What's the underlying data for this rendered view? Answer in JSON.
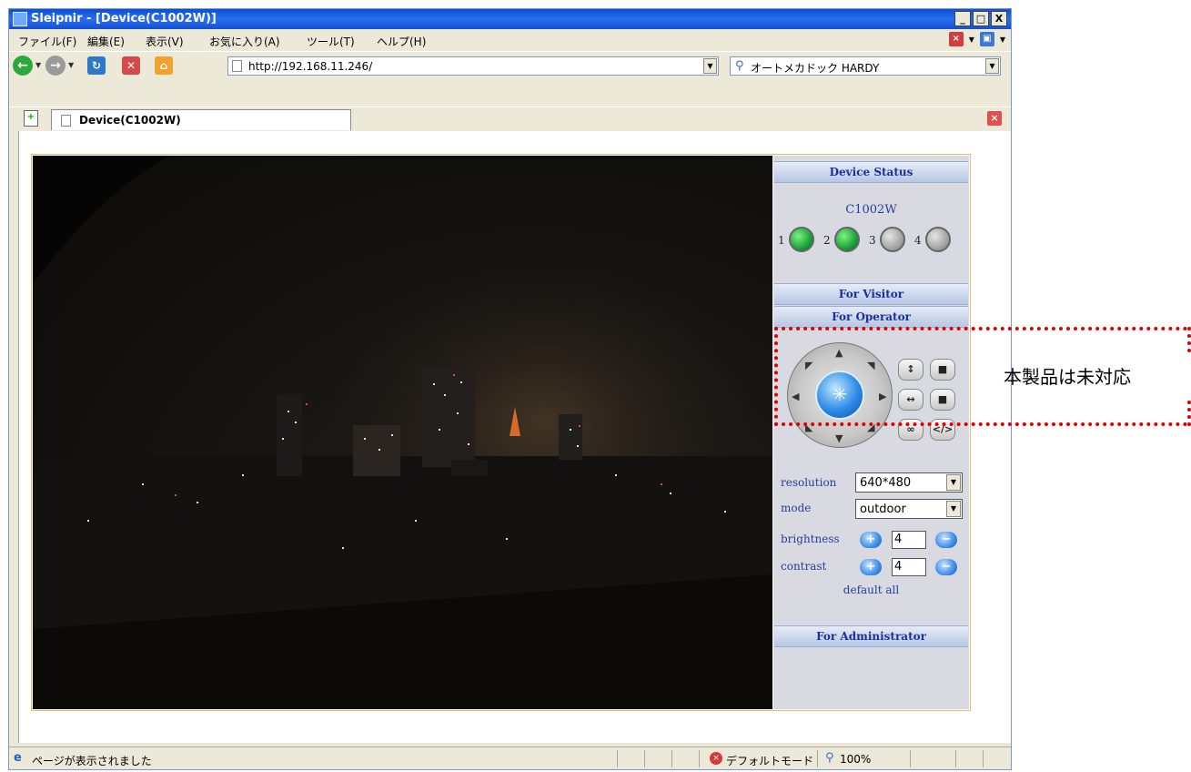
{
  "window": {
    "title": "Sleipnir - [Device(C1002W)]",
    "controls": [
      "_",
      "□",
      "X"
    ]
  },
  "menubar": {
    "items": [
      "ファイル(F)",
      "編集(E)",
      "表示(V)",
      "お気に入り(A)",
      "ツール(T)",
      "ヘルプ(H)"
    ]
  },
  "toolbar": {
    "address": "http://192.168.11.246/",
    "search": "オートメカドック HARDY"
  },
  "tab": {
    "label": "Device(C1002W)"
  },
  "panel": {
    "device_status_header": "Device Status",
    "device_name": "C1002W",
    "leds": [
      {
        "num": "1",
        "on": true
      },
      {
        "num": "2",
        "on": true
      },
      {
        "num": "3",
        "on": false
      },
      {
        "num": "4",
        "on": false
      }
    ],
    "visitor_header": "For Visitor",
    "operator_header": "For Operator",
    "resolution_label": "resolution",
    "resolution_value": "640*480",
    "mode_label": "mode",
    "mode_value": "outdoor",
    "brightness_label": "brightness",
    "brightness_value": "4",
    "contrast_label": "contrast",
    "contrast_value": "4",
    "default_all": "default all",
    "admin_header": "For Administrator"
  },
  "statusbar": {
    "text": "ページが表示されました",
    "mode": "デフォルトモード",
    "zoom": "100%"
  },
  "annotation": {
    "text": "本製品は未対応"
  }
}
